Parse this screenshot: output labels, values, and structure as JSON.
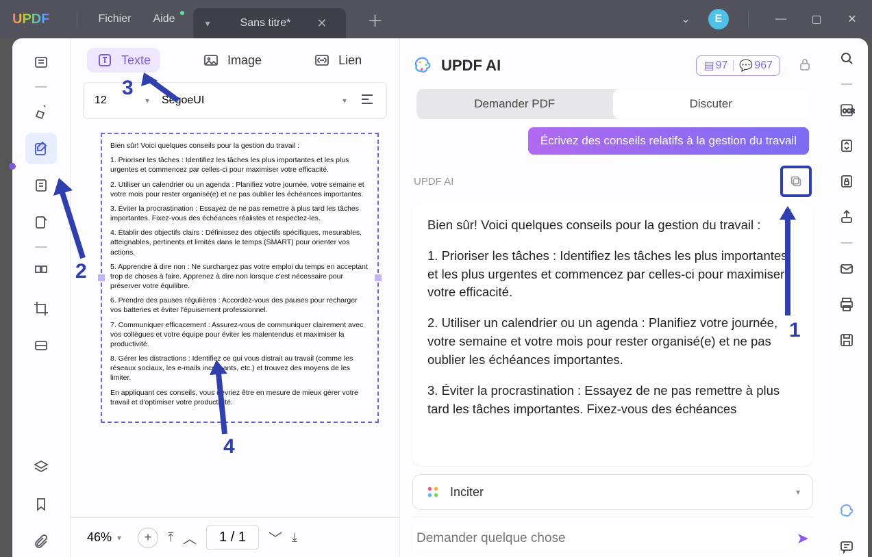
{
  "titlebar": {
    "menu_file": "Fichier",
    "menu_help": "Aide",
    "tab_title": "Sans titre*",
    "avatar_letter": "E"
  },
  "editbar": {
    "text": "Texte",
    "image": "Image",
    "link": "Lien"
  },
  "format": {
    "size": "12",
    "font": "SegoeUI"
  },
  "document": {
    "intro": "Bien sûr! Voici quelques conseils pour la gestion du travail :",
    "p1": "1. Prioriser les tâches : Identifiez les tâches les plus importantes et les plus urgentes et commencez par celles-ci pour maximiser votre efficacité.",
    "p2": "2. Utiliser un calendrier ou un agenda : Planifiez votre journée, votre semaine et votre mois pour rester organisé(e) et ne pas oublier les échéances importantes.",
    "p3": "3. Éviter la procrastination : Essayez de ne pas remettre à plus tard les tâches importantes. Fixez-vous des échéances réalistes et respectez-les.",
    "p4": "4. Établir des objectifs clairs : Définissez des objectifs spécifiques, mesurables, atteignables, pertinents et limités dans le temps (SMART) pour orienter vos actions.",
    "p5": "5. Apprendre à dire non : Ne surchargez pas votre emploi du temps en acceptant trop de choses à faire. Apprenez à dire non lorsque c'est nécessaire pour préserver votre équilibre.",
    "p6": "6. Prendre des pauses régulières : Accordez-vous des pauses pour recharger vos batteries et éviter l'épuisement professionnel.",
    "p7": "7. Communiquer efficacement : Assurez-vous de communiquer clairement avec vos collègues et votre équipe pour éviter les malentendus et maximiser la productivité.",
    "p8": "8. Gérer les distractions : Identifiez ce qui vous distrait au travail (comme les réseaux sociaux, les e-mails incessants, etc.) et trouvez des moyens de les limiter.",
    "outro": "En appliquant ces conseils, vous devriez être en mesure de mieux gérer votre travail et d'optimiser votre productivité."
  },
  "bottombar": {
    "zoom": "46%",
    "page": "1 / 1"
  },
  "ai": {
    "title": "UPDF AI",
    "credits1": "97",
    "credits2": "967",
    "tab_pdf": "Demander PDF",
    "tab_chat": "Discuter",
    "user_prompt": "Écrivez des conseils relatifs à la gestion du travail",
    "source_label": "UPDF AI",
    "resp_intro": "Bien sûr! Voici quelques conseils pour la gestion du travail :",
    "resp_p1": "1. Prioriser les tâches : Identifiez les tâches les plus importantes et les plus urgentes et commencez par celles-ci pour maximiser votre efficacité.",
    "resp_p2": "2. Utiliser un calendrier ou un agenda : Planifiez votre journée, votre semaine et votre mois pour rester organisé(e) et ne pas oublier les échéances importantes.",
    "resp_p3": "3. Éviter la procrastination : Essayez de ne pas remettre à plus tard les tâches importantes. Fixez-vous des échéances",
    "inciter": "Inciter",
    "input_placeholder": "Demander quelque chose"
  },
  "annotations": {
    "n1": "1",
    "n2": "2",
    "n3": "3",
    "n4": "4"
  }
}
